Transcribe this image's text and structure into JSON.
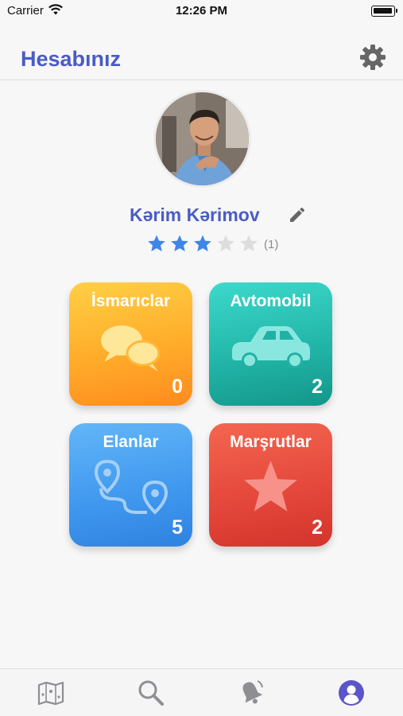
{
  "status_bar": {
    "carrier": "Carrier",
    "time": "12:26 PM"
  },
  "header": {
    "title": "Hesabınız",
    "settings_icon": "gear-icon"
  },
  "profile": {
    "name": "Kərim Kərimov",
    "rating": 3,
    "max_rating": 5,
    "rating_count": "(1)",
    "edit_icon": "pencil-icon"
  },
  "tiles": [
    {
      "label": "İsmarıclar",
      "count": "0",
      "icon": "chat-bubbles-icon",
      "color": "#ffac2a"
    },
    {
      "label": "Avtomobil",
      "count": "2",
      "icon": "car-icon",
      "color": "#20b3a5"
    },
    {
      "label": "Elanlar",
      "count": "5",
      "icon": "route-pins-icon",
      "color": "#3f97ee"
    },
    {
      "label": "Marşrutlar",
      "count": "2",
      "icon": "star-icon",
      "color": "#e3463a"
    }
  ],
  "tab_bar": {
    "items": [
      {
        "icon": "map-icon",
        "active": false
      },
      {
        "icon": "search-icon",
        "active": false
      },
      {
        "icon": "notification-bell-icon",
        "active": false
      },
      {
        "icon": "profile-icon",
        "active": true
      }
    ]
  },
  "colors": {
    "accent": "#4a5cc4",
    "star_active": "#3f86e8",
    "star_inactive": "#dddddd",
    "tab_inactive": "#8e8e93",
    "tab_active": "#5a55c8"
  }
}
